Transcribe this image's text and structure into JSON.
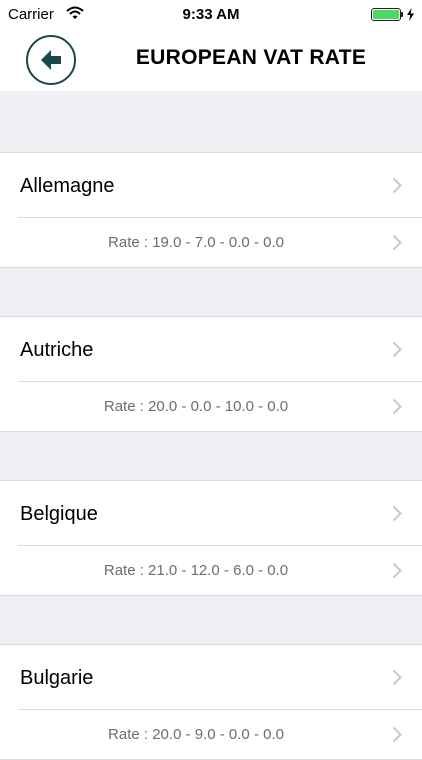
{
  "status_bar": {
    "carrier": "Carrier",
    "time": "9:33 AM",
    "battery_color": "#4cd964"
  },
  "nav": {
    "title": "EUROPEAN VAT RATE",
    "back_icon": "back-arrow-icon",
    "accent_color": "#18494a"
  },
  "countries": [
    {
      "name": "Allemagne",
      "rate": "Rate : 19.0 - 7.0 - 0.0 - 0.0"
    },
    {
      "name": "Autriche",
      "rate": "Rate : 20.0 - 0.0 - 10.0 - 0.0"
    },
    {
      "name": "Belgique",
      "rate": "Rate : 21.0 - 12.0 - 6.0 - 0.0"
    },
    {
      "name": "Bulgarie",
      "rate": "Rate : 20.0 - 9.0 - 0.0 - 0.0"
    }
  ]
}
